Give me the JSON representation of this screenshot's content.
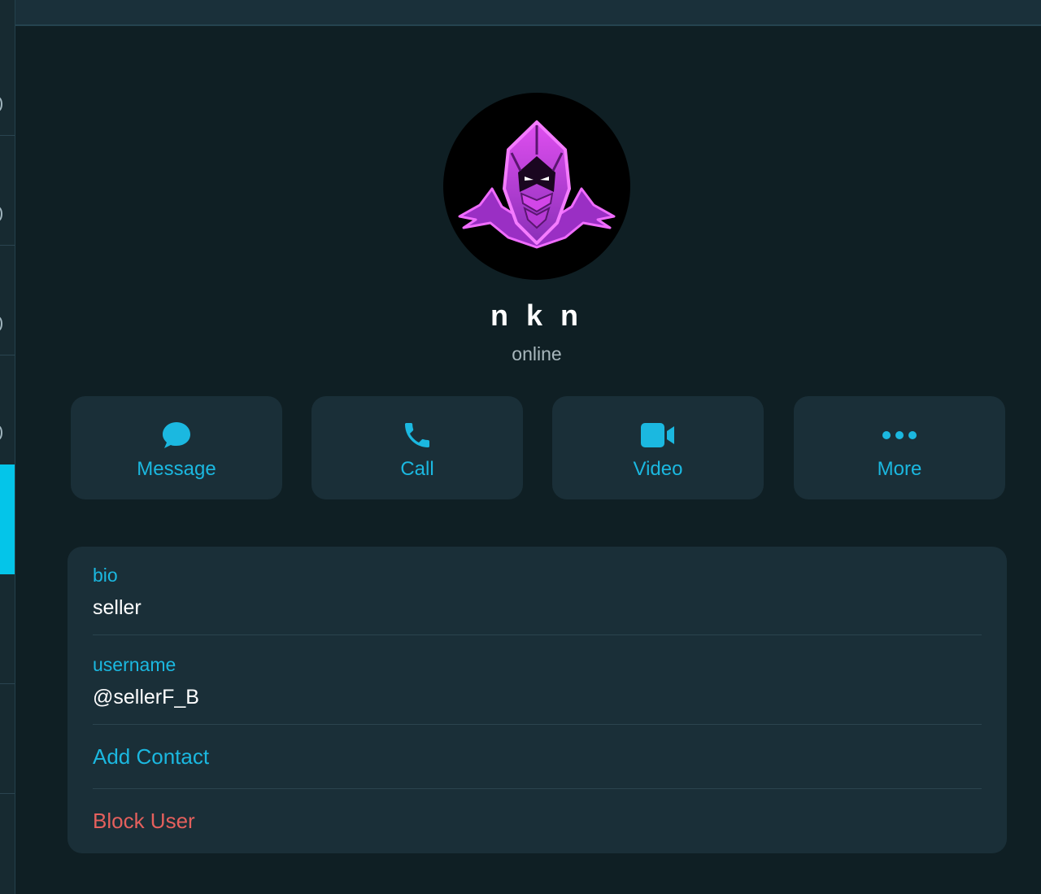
{
  "profile": {
    "name": "n k n",
    "status": "online"
  },
  "actions": [
    {
      "label": "Message",
      "icon": "chat-bubble-icon"
    },
    {
      "label": "Call",
      "icon": "phone-icon"
    },
    {
      "label": "Video",
      "icon": "video-camera-icon"
    },
    {
      "label": "More",
      "icon": "more-dots-icon"
    }
  ],
  "info": {
    "bio_label": "bio",
    "bio_value": "seller",
    "username_label": "username",
    "username_value": "@sellerF_B",
    "add_contact": "Add Contact",
    "block_user": "Block User"
  },
  "colors": {
    "accent": "#1bb8e0",
    "danger": "#e5605d",
    "sidebar_active": "#04c5e9",
    "background": "#0f1f24",
    "card": "#1a2f38",
    "avatar_glyph": "#c33ad9"
  }
}
